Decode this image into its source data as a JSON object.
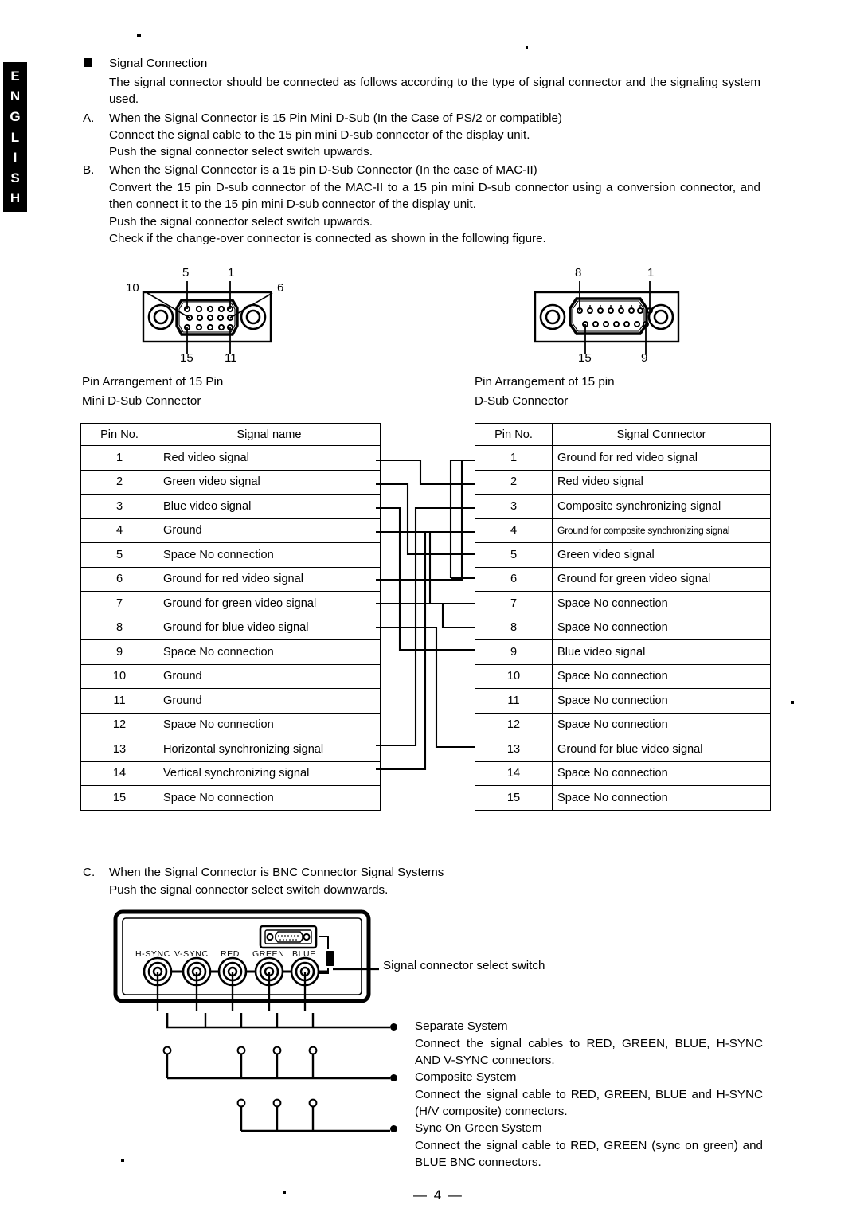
{
  "page": {
    "language_tab": [
      "E",
      "N",
      "G",
      "L",
      "I",
      "S",
      "H"
    ],
    "page_number": "— 4 —"
  },
  "section_signal_connection": {
    "heading": "Signal Connection",
    "intro": "The signal connector should be connected as follows according to the type of signal connector and the signaling system used.",
    "items": [
      {
        "marker": "A.",
        "title": "When the Signal Connector is 15 Pin Mini D-Sub (In the Case of PS/2 or compatible)",
        "lines": [
          "Connect the signal cable to the 15 pin mini D-sub connector of the display unit.",
          "Push the signal connector select switch upwards."
        ]
      },
      {
        "marker": "B.",
        "title": "When the Signal Connector is a 15 pin D-Sub Connector (In the case of MAC-II)",
        "body": "Convert the 15 pin D-sub connector of the MAC-II to a 15 pin mini D-sub connector using a conversion connector, and then connect it to the 15 pin mini D-sub connector of the display unit.",
        "lines": [
          "Push the signal connector select switch upwards.",
          "Check if the change-over connector is connected as shown in the following figure."
        ]
      }
    ]
  },
  "connector_figures": {
    "mini_dsub": {
      "caption_line1": "Pin Arrangement of 15 Pin",
      "caption_line2": "Mini D-Sub Connector",
      "pin_labels": {
        "top_left": "5",
        "top_right": "1",
        "left": "10",
        "right": "6",
        "bottom_left": "15",
        "bottom_right": "11"
      },
      "row_counts": [
        5,
        5,
        5
      ]
    },
    "dsub": {
      "caption_line1": "Pin Arrangement of 15 pin",
      "caption_line2": "D-Sub Connector",
      "pin_labels": {
        "top_left": "8",
        "top_right": "1",
        "bottom_left": "15",
        "bottom_right": "9"
      },
      "row_counts": [
        8,
        7
      ]
    }
  },
  "table_mini_dsub": {
    "headers": [
      "Pin No.",
      "Signal name"
    ],
    "rows": [
      {
        "pin": "1",
        "signal": "Red video signal"
      },
      {
        "pin": "2",
        "signal": "Green video signal"
      },
      {
        "pin": "3",
        "signal": "Blue video signal"
      },
      {
        "pin": "4",
        "signal": "Ground"
      },
      {
        "pin": "5",
        "signal": "Space No connection"
      },
      {
        "pin": "6",
        "signal": "Ground for red video signal"
      },
      {
        "pin": "7",
        "signal": "Ground for green video signal"
      },
      {
        "pin": "8",
        "signal": "Ground for blue video signal"
      },
      {
        "pin": "9",
        "signal": "Space No connection"
      },
      {
        "pin": "10",
        "signal": "Ground"
      },
      {
        "pin": "11",
        "signal": "Ground"
      },
      {
        "pin": "12",
        "signal": "Space No connection"
      },
      {
        "pin": "13",
        "signal": "Horizontal synchronizing signal"
      },
      {
        "pin": "14",
        "signal": "Vertical synchronizing signal"
      },
      {
        "pin": "15",
        "signal": "Space No connection"
      }
    ]
  },
  "table_dsub": {
    "headers": [
      "Pin No.",
      "Signal Connector"
    ],
    "rows": [
      {
        "pin": "1",
        "signal": "Ground for red video signal"
      },
      {
        "pin": "2",
        "signal": "Red video signal"
      },
      {
        "pin": "3",
        "signal": "Composite synchronizing signal"
      },
      {
        "pin": "4",
        "signal": "Ground for composite synchronizing signal",
        "condensed": true
      },
      {
        "pin": "5",
        "signal": "Green video signal"
      },
      {
        "pin": "6",
        "signal": "Ground for green video signal"
      },
      {
        "pin": "7",
        "signal": "Space No connection"
      },
      {
        "pin": "8",
        "signal": "Space No connection"
      },
      {
        "pin": "9",
        "signal": "Blue video signal"
      },
      {
        "pin": "10",
        "signal": "Space No connection"
      },
      {
        "pin": "11",
        "signal": "Space No connection"
      },
      {
        "pin": "12",
        "signal": "Space No connection"
      },
      {
        "pin": "13",
        "signal": "Ground for blue video signal"
      },
      {
        "pin": "14",
        "signal": "Space No connection"
      },
      {
        "pin": "15",
        "signal": "Space No connection"
      }
    ]
  },
  "section_bnc": {
    "marker": "C.",
    "title": "When the Signal Connector is BNC Connector Signal Systems",
    "line2": "Push the signal connector select switch downwards.",
    "panel_labels": [
      "H-SYNC",
      "V-SYNC",
      "RED",
      "GREEN",
      "BLUE"
    ],
    "switch_callout": "Signal connector select switch",
    "systems": [
      {
        "name": "Separate System",
        "description": "Connect the signal cables to RED, GREEN, BLUE, H-SYNC AND V-SYNC connectors."
      },
      {
        "name": "Composite System",
        "description": "Connect the signal cable to RED, GREEN, BLUE and H-SYNC (H/V composite) connectors."
      },
      {
        "name": "Sync On Green System",
        "description": "Connect the signal cable to RED, GREEN (sync on green) and BLUE BNC connectors."
      }
    ]
  }
}
